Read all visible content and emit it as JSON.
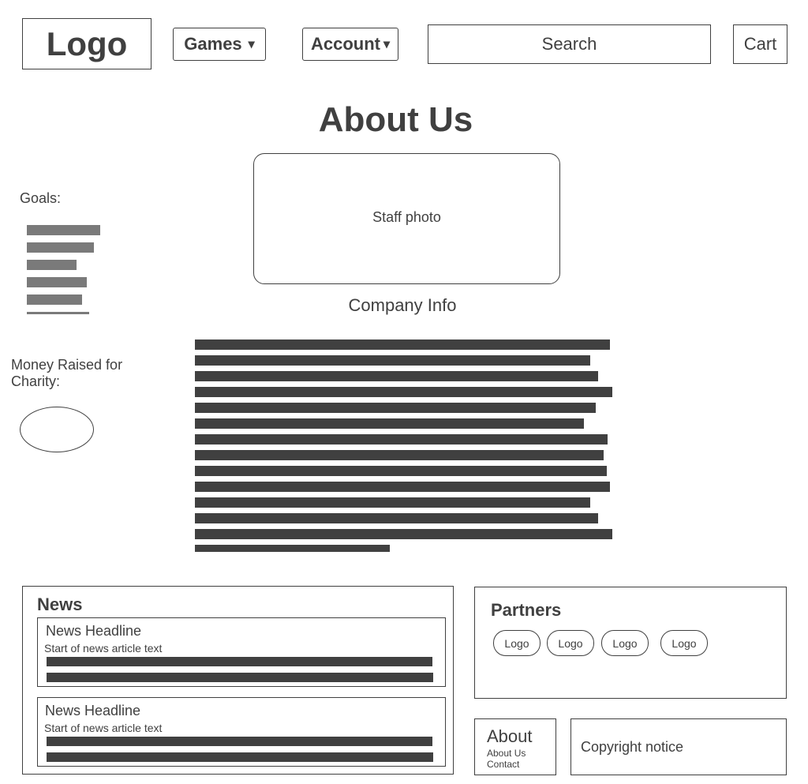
{
  "header": {
    "logo": "Logo",
    "games": "Games",
    "account": "Account",
    "dropdown_icon": "▾",
    "search_placeholder": "Search",
    "cart": "Cart"
  },
  "page": {
    "title": "About Us",
    "staff_photo": "Staff photo",
    "company_info": "Company Info"
  },
  "sidebar": {
    "goals_label": "Goals:",
    "money_label": "Money Raised for Charity:"
  },
  "news": {
    "title": "News",
    "items": [
      {
        "headline": "News Headline",
        "snippet": "Start of news article text"
      },
      {
        "headline": "News Headline",
        "snippet": "Start of news article text"
      }
    ]
  },
  "partners": {
    "title": "Partners",
    "logos": [
      "Logo",
      "Logo",
      "Logo",
      "Logo"
    ]
  },
  "footer": {
    "about_title": "About",
    "links": [
      "About Us",
      "Contact"
    ],
    "copyright": "Copyright notice"
  },
  "colors": {
    "text": "#404040",
    "placeholder_dark": "#404040",
    "placeholder_light": "#7a7a7a"
  }
}
